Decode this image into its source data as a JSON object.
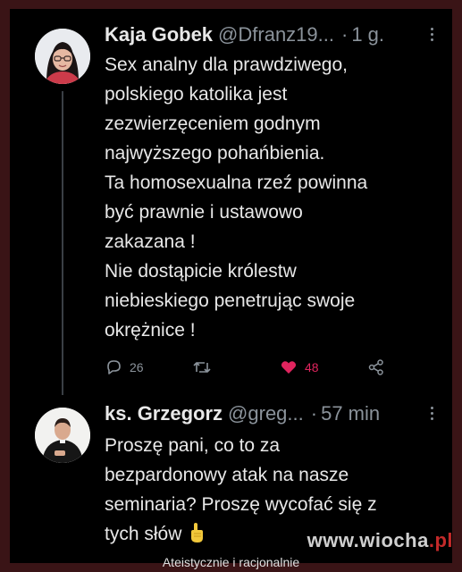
{
  "tweet1": {
    "author_name": "Kaja Gobek",
    "handle": "@Dfranz19...",
    "separator": "·",
    "time": "1 g.",
    "lines": [
      "Sex analny dla prawdziwego,",
      "polskiego katolika jest",
      "zezwierzęceniem godnym",
      "najwyższego pohańbienia.",
      "Ta homosexualna rzeź powinna",
      "być prawnie i ustawowo",
      "zakazana !",
      "Nie dostąpicie królestw",
      "niebieskiego penetrując swoje",
      "okrężnice !"
    ],
    "reply_count": "26",
    "like_count": "48"
  },
  "tweet2": {
    "author_name": "ks. Grzegorz",
    "handle": "@greg...",
    "separator": "·",
    "time": "57 min",
    "lines": [
      "Proszę pani, co to za",
      "bezpardonowy atak na nasze",
      "seminaria? Proszę wycofać się z",
      "tych słów"
    ]
  },
  "watermark": {
    "main": "www.wiocha",
    "suffix": ".pl"
  },
  "caption": "Ateistycznie i racjonalnie",
  "colors": {
    "like": "#e0245e",
    "muted": "#8b939b",
    "text": "#e8e8e8",
    "background": "#000000"
  }
}
